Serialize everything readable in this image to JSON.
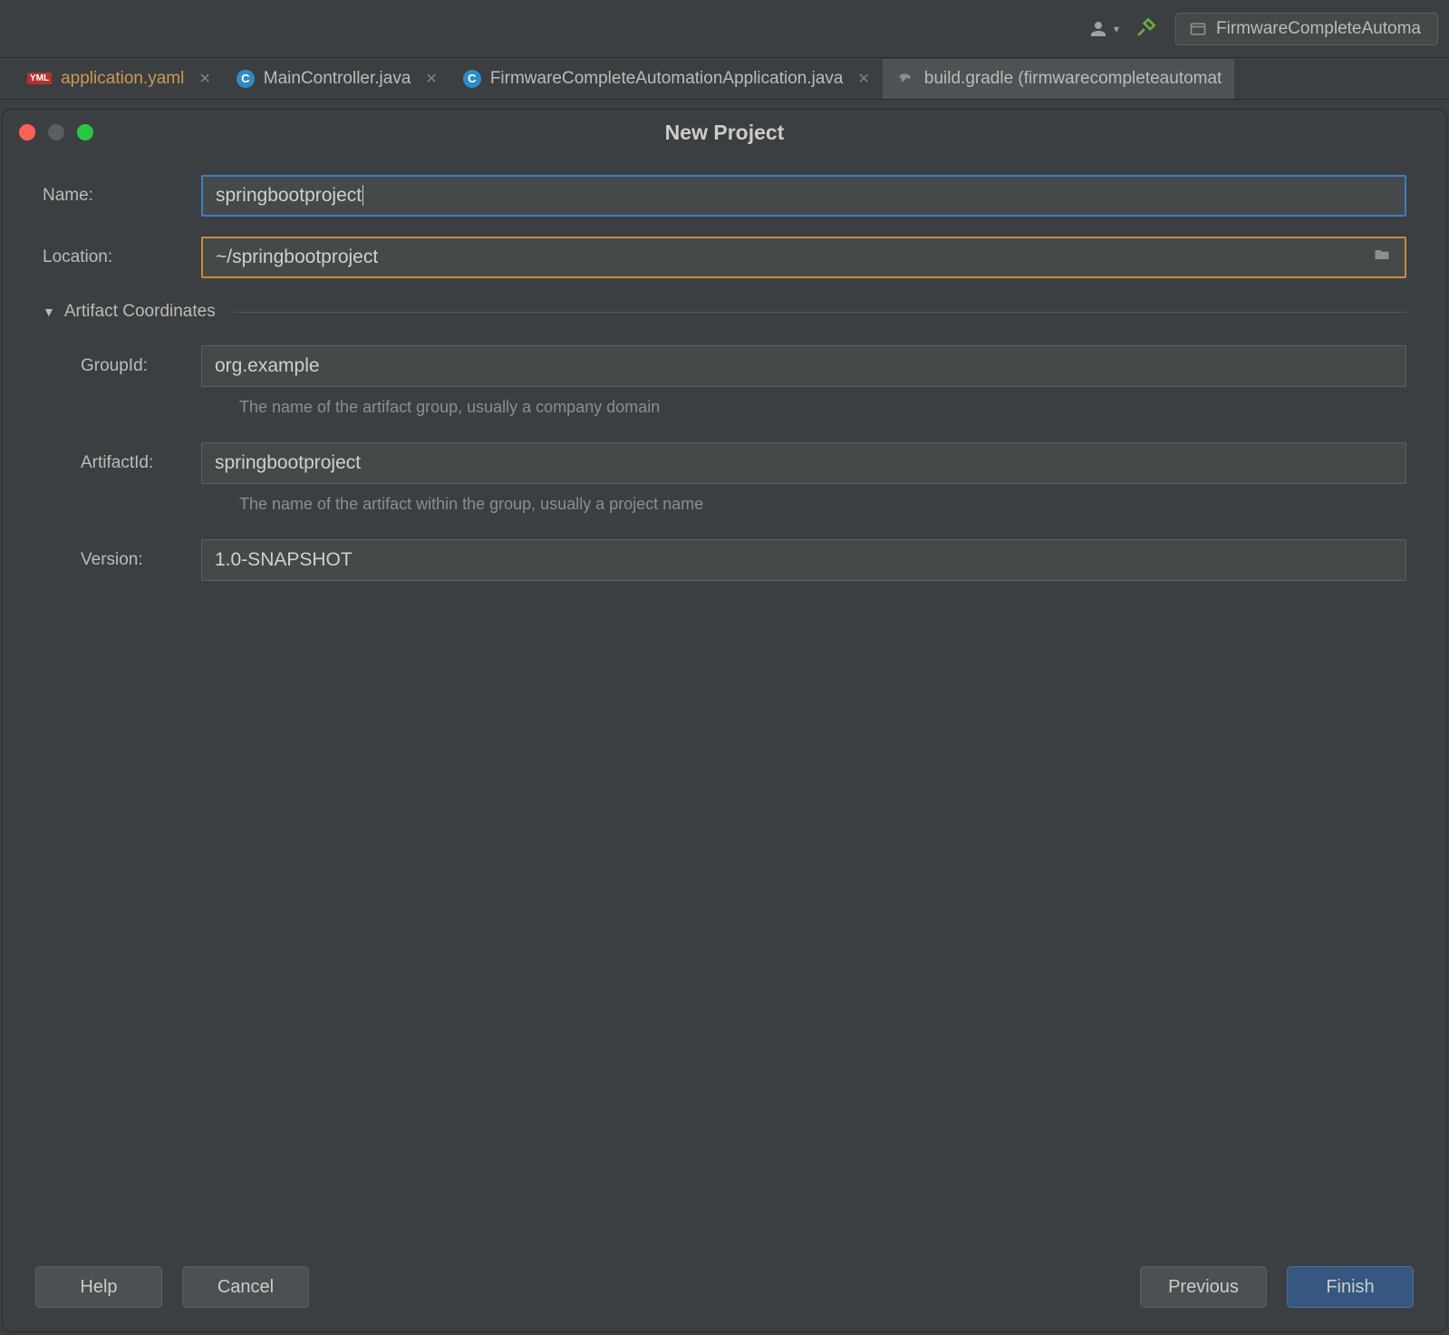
{
  "toolbar": {
    "run_config_label": "FirmwareCompleteAutoma"
  },
  "tabs": [
    {
      "label": "application.yaml",
      "type": "yaml"
    },
    {
      "label": "MainController.java",
      "type": "java"
    },
    {
      "label": "FirmwareCompleteAutomationApplication.java",
      "type": "java"
    },
    {
      "label": "build.gradle (firmwarecompleteautomat",
      "type": "gradle"
    }
  ],
  "dialog": {
    "title": "New Project",
    "labels": {
      "name": "Name:",
      "location": "Location:",
      "artifact_section": "Artifact Coordinates",
      "group_id": "GroupId:",
      "artifact_id": "ArtifactId:",
      "version": "Version:"
    },
    "values": {
      "name": "springbootproject",
      "location": "~/springbootproject",
      "group_id": "org.example",
      "artifact_id": "springbootproject",
      "version": "1.0-SNAPSHOT"
    },
    "hints": {
      "group_id": "The name of the artifact group, usually a company domain",
      "artifact_id": "The name of the artifact within the group, usually a project name"
    },
    "buttons": {
      "help": "Help",
      "cancel": "Cancel",
      "previous": "Previous",
      "finish": "Finish"
    }
  }
}
